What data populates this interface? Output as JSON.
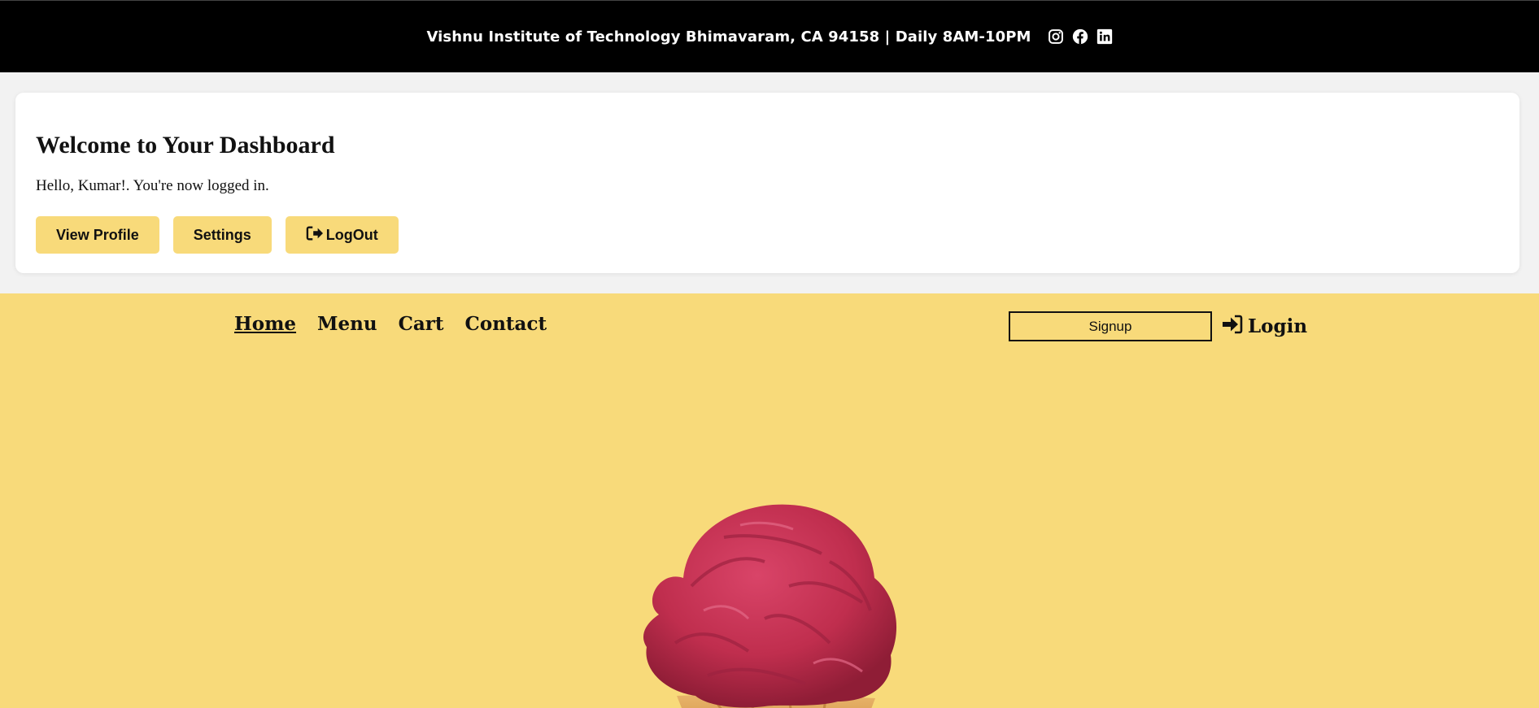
{
  "topbar": {
    "info": "Vishnu Institute of Technology Bhimavaram, CA 94158 | Daily 8AM-10PM",
    "socials": [
      "instagram-icon",
      "facebook-icon",
      "linkedin-icon"
    ]
  },
  "dashboard": {
    "title": "Welcome to Your Dashboard",
    "greeting": "Hello, Kumar!. You're now logged in.",
    "buttons": {
      "view_profile": "View Profile",
      "settings": "Settings",
      "logout": "LogOut"
    }
  },
  "nav": {
    "items": [
      "Home",
      "Menu",
      "Cart",
      "Contact"
    ],
    "active": "Home",
    "signup": "Signup",
    "login": "Login"
  },
  "colors": {
    "accent": "#f8da7a",
    "topbar_bg": "#000000",
    "page_bg": "#f2f2f2",
    "scoop": "#c8304f"
  },
  "hero": {
    "image": "ice-cream-cone"
  }
}
